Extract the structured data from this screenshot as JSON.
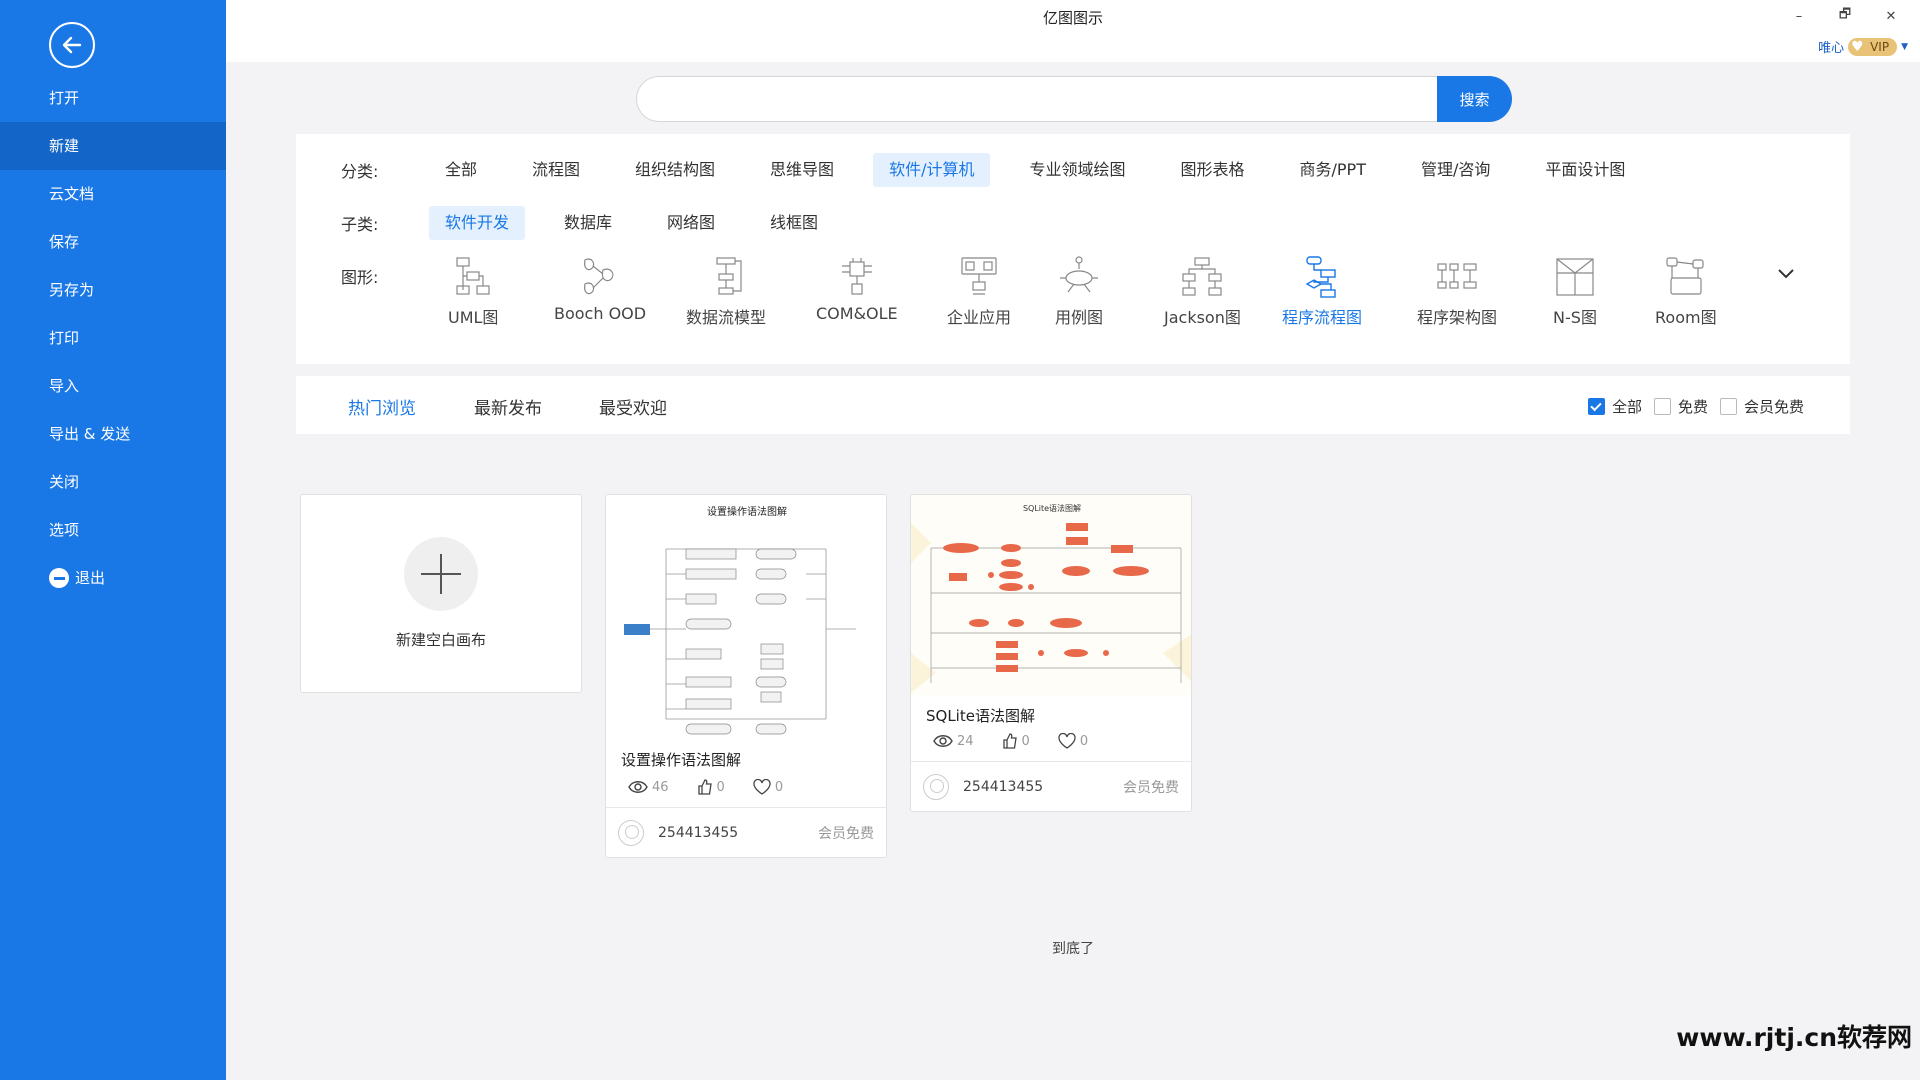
{
  "sidebar": {
    "items": [
      {
        "label": "打开"
      },
      {
        "label": "新建"
      },
      {
        "label": "云文档"
      },
      {
        "label": "保存"
      },
      {
        "label": "另存为"
      },
      {
        "label": "打印"
      },
      {
        "label": "导入"
      },
      {
        "label": "导出 & 发送"
      },
      {
        "label": "关闭"
      },
      {
        "label": "选项"
      },
      {
        "label": "退出"
      }
    ],
    "active_index": 1,
    "bg_color": "#1a78e6"
  },
  "titlebar": {
    "title": "亿图图示",
    "user_name": "唯心",
    "vip_label": "VIP",
    "minimize": "–",
    "restore": "🗗",
    "close": "✕"
  },
  "search": {
    "value": "",
    "button_label": "搜索"
  },
  "filters": {
    "category_label": "分类:",
    "categories": [
      "全部",
      "流程图",
      "组织结构图",
      "思维导图",
      "软件/计算机",
      "专业领域绘图",
      "图形表格",
      "商务/PPT",
      "管理/咨询",
      "平面设计图"
    ],
    "category_active": 4,
    "sub_label": "子类:",
    "subcategories": [
      "软件开发",
      "数据库",
      "网络图",
      "线框图"
    ],
    "sub_active": 0,
    "shape_label": "图形:",
    "shapes": [
      "UML图",
      "Booch OOD",
      "数据流模型",
      "COM&OLE",
      "企业应用",
      "用例图",
      "Jackson图",
      "程序流程图",
      "程序架构图",
      "N-S图",
      "Room图"
    ],
    "shape_active": 7,
    "expand_icon": "chevron-down-icon"
  },
  "tabs": {
    "items": [
      "热门浏览",
      "最新发布",
      "最受欢迎"
    ],
    "active": 0,
    "checks": [
      {
        "label": "全部",
        "checked": true
      },
      {
        "label": "免费",
        "checked": false
      },
      {
        "label": "会员免费",
        "checked": false
      }
    ]
  },
  "cards": {
    "new_blank": "新建空白画布",
    "templates": [
      {
        "title": "设置操作语法图解",
        "preview_title": "设置操作语法图解",
        "views": "46",
        "likes": "0",
        "favorites": "0",
        "author": "254413455",
        "price": "会员免费"
      },
      {
        "title": "SQLite语法图解",
        "preview_title": "SQLite语法图解",
        "views": "24",
        "likes": "0",
        "favorites": "0",
        "author": "254413455",
        "price": "会员免费"
      }
    ]
  },
  "footer": {
    "end_text": "到底了",
    "watermark": "www.rjtj.cn软荐网"
  },
  "colors": {
    "accent": "#1a78e6",
    "active_chip_bg": "#e4f0fd",
    "vip_gold": "#e8c377",
    "diagram_orange": "#e8684a"
  }
}
